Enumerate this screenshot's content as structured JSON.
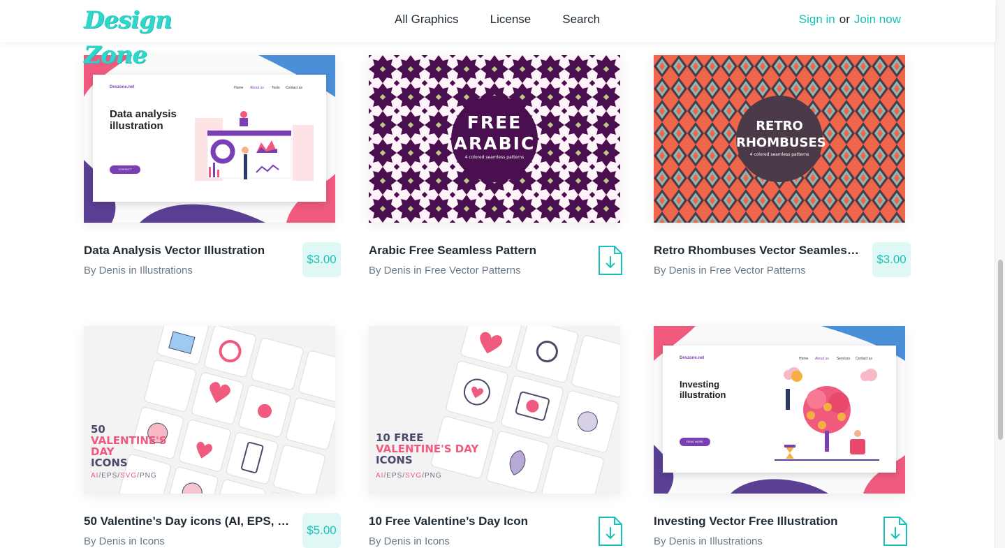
{
  "header": {
    "logo_text": "Design Zone",
    "nav": [
      "All Graphics",
      "License",
      "Search"
    ],
    "sign_in": "Sign in",
    "or": "or",
    "join_now": "Join now"
  },
  "colors": {
    "accent": "#19c2b8",
    "price_bg": "#dff8f6",
    "purple": "#7a3fb4",
    "pink": "#f05a7e"
  },
  "cards": [
    {
      "title": "Data Analysis Vector Illustration",
      "author": "By Denis in Illustrations",
      "price": "$3.00",
      "thumb": {
        "site": "Deszone.net",
        "nav": [
          "Home",
          "About us",
          "Tools",
          "Contact us"
        ],
        "heading_1": "Data analysis",
        "heading_2": "illustration",
        "button": "CONTACT"
      }
    },
    {
      "title": "Arabic Free Seamless Pattern",
      "author": "By Denis in Free Vector Patterns",
      "action": "download",
      "thumb": {
        "badge_1": "FREE",
        "badge_2": "ARABIC",
        "badge_sub": "4 colored seamless patterns"
      }
    },
    {
      "title": "Retro Rhombuses Vector Seamles…",
      "author": "By Denis in Free Vector Patterns",
      "price": "$3.00",
      "thumb": {
        "badge_1": "RETRO",
        "badge_2": "RHOMBUSES",
        "badge_sub": "4 colored seamless patterns"
      }
    },
    {
      "title": "50 Valentine’s Day icons (AI, EPS, …",
      "author": "By Denis in Icons",
      "price": "$5.00",
      "thumb": {
        "line_1": "50",
        "line_2": "VALENTINE'S",
        "line_3": "DAY",
        "line_4": "ICONS",
        "formats": [
          "AI",
          "EPS",
          "SVG",
          "PNG"
        ]
      }
    },
    {
      "title": "10 Free Valentine’s Day Icon",
      "author": "By Denis in Icons",
      "action": "download",
      "thumb": {
        "line_1": "10 FREE",
        "line_2": "VALENTINE'S DAY",
        "line_3": "ICONS",
        "formats": [
          "AI",
          "EPS",
          "SVG",
          "PNG"
        ]
      }
    },
    {
      "title": "Investing Vector Free Illustration",
      "author": "By Denis in Illustrations",
      "action": "download",
      "thumb": {
        "site": "Deszone.net",
        "nav": [
          "Home",
          "About us",
          "Services",
          "Contact us"
        ],
        "heading_1": "Investing",
        "heading_2": "illustration",
        "button": "READ MORE"
      }
    }
  ]
}
